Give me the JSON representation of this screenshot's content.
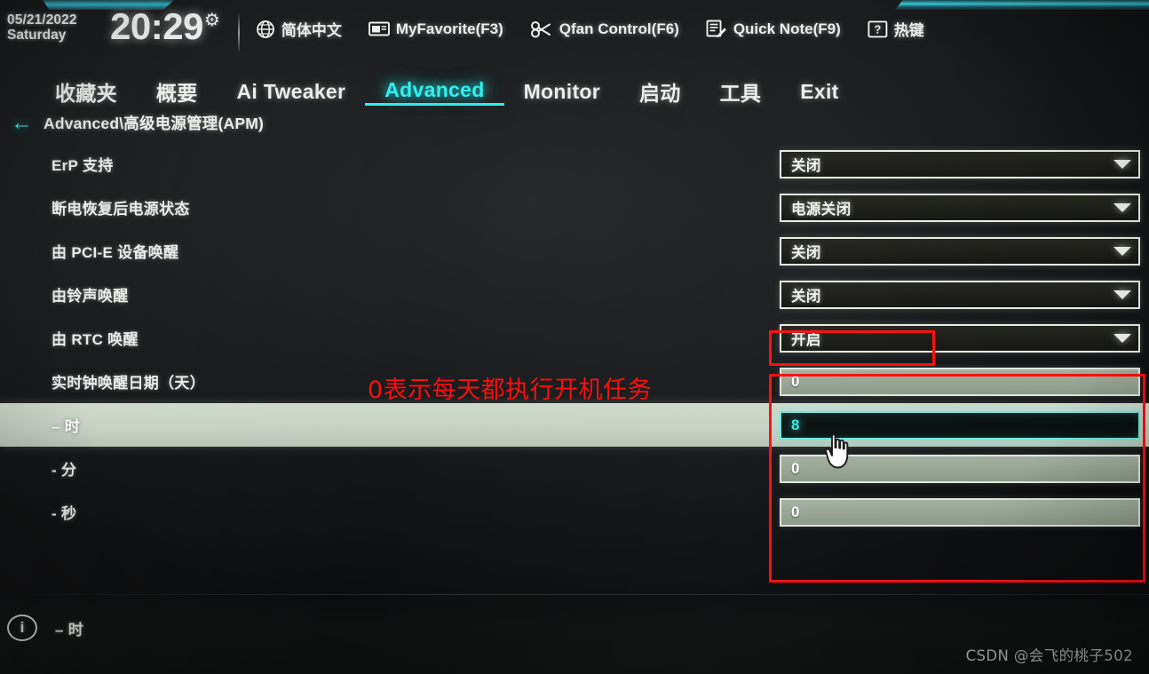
{
  "header": {
    "date": "05/21/2022",
    "weekday": "Saturday",
    "time": "20:29",
    "gear_icon": "gear-icon",
    "tools": [
      {
        "icon": "globe-icon",
        "label": "简体中文"
      },
      {
        "icon": "folder-icon",
        "label": "MyFavorite(F3)"
      },
      {
        "icon": "fan-icon",
        "label": "Qfan Control(F6)"
      },
      {
        "icon": "note-pencil-icon",
        "label": "Quick Note(F9)"
      },
      {
        "icon": "question-box-icon",
        "label": "热键"
      }
    ]
  },
  "tabs": [
    {
      "label": "收藏夹",
      "active": false
    },
    {
      "label": "概要",
      "active": false
    },
    {
      "label": "Ai Tweaker",
      "active": false
    },
    {
      "label": "Advanced",
      "active": true
    },
    {
      "label": "Monitor",
      "active": false
    },
    {
      "label": "启动",
      "active": false
    },
    {
      "label": "工具",
      "active": false
    },
    {
      "label": "Exit",
      "active": false
    }
  ],
  "breadcrumb": {
    "back_icon": "back-arrow-icon",
    "path": "Advanced\\高级电源管理(APM)"
  },
  "settings": [
    {
      "label": "ErP 支持",
      "control": "dropdown",
      "value": "关闭",
      "highlighted": false
    },
    {
      "label": "断电恢复后电源状态",
      "control": "dropdown",
      "value": "电源关闭",
      "highlighted": false
    },
    {
      "label": "由 PCI-E 设备唤醒",
      "control": "dropdown",
      "value": "关闭",
      "highlighted": false
    },
    {
      "label": "由铃声唤醒",
      "control": "dropdown",
      "value": "关闭",
      "highlighted": false
    },
    {
      "label": "由 RTC 唤醒",
      "control": "dropdown",
      "value": "开启",
      "highlighted": false
    },
    {
      "label": "实时钟唤醒日期（天）",
      "control": "number",
      "value": "0",
      "highlighted": false,
      "focused": false
    },
    {
      "label": "– 时",
      "control": "number",
      "value": "8",
      "highlighted": true,
      "focused": true
    },
    {
      "label": "- 分",
      "control": "number",
      "value": "0",
      "highlighted": false,
      "focused": false
    },
    {
      "label": "- 秒",
      "control": "number",
      "value": "0",
      "highlighted": false,
      "focused": false
    }
  ],
  "annotation": {
    "text": "0表示每天都执行开机任务",
    "color": "#fb0d0d"
  },
  "footer": {
    "info_icon": "info-icon",
    "label": "– 时"
  },
  "watermark": "CSDN @会飞的桃子502",
  "colors": {
    "accent_cyan": "#2ff0f0",
    "annotation_red": "#fb0d0d",
    "highlight_row": "#c7d2c4",
    "field_grey": "#97a594",
    "focus_cyan": "#37e9e4"
  }
}
